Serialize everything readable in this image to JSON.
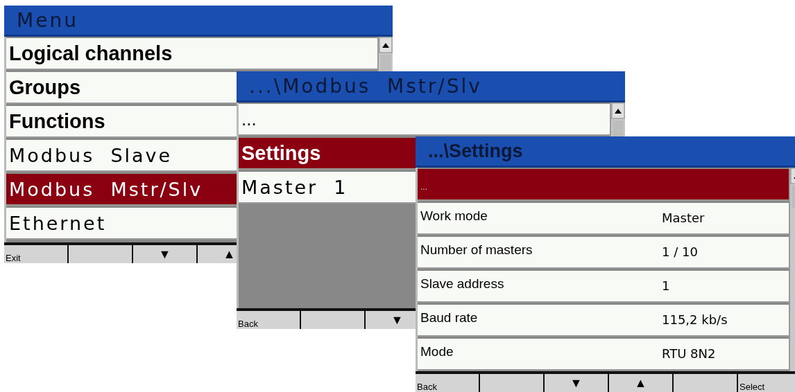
{
  "windows": [
    {
      "title": {
        "text": "Menu",
        "kind": "wide"
      },
      "items": [
        {
          "label": "Logical channels",
          "kind": "bold",
          "selected": false
        },
        {
          "label": "Groups",
          "kind": "bold",
          "selected": false
        },
        {
          "label": "Functions",
          "kind": "bold",
          "selected": false
        },
        {
          "label": "Modbus  Slave",
          "kind": "wide",
          "selected": false
        },
        {
          "label": "Modbus  Mstr/Slv",
          "kind": "wide",
          "selected": true
        },
        {
          "label": "Ethernet",
          "kind": "wide",
          "selected": false
        }
      ],
      "buttons": [
        {
          "label": "Exit",
          "kind": "text"
        },
        {
          "kind": "blank"
        },
        {
          "label": "▼",
          "kind": "arrow"
        },
        {
          "label": "▲",
          "kind": "arrow"
        }
      ]
    },
    {
      "title": {
        "text": "...\\Modbus  Mstr/Slv",
        "kind": "wide"
      },
      "items": [
        {
          "label": "...",
          "kind": "plain",
          "selected": false
        },
        {
          "label": "Settings",
          "kind": "bold",
          "selected": true
        },
        {
          "label": "Master  1",
          "kind": "wide",
          "selected": false
        }
      ],
      "buttons": [
        {
          "label": "Back",
          "kind": "text"
        },
        {
          "kind": "blank"
        },
        {
          "label": "▼",
          "kind": "arrow"
        }
      ]
    },
    {
      "title": {
        "text": "...\\Settings",
        "kind": "bold"
      },
      "items": [
        {
          "label": "...",
          "kind": "small",
          "selected": true
        },
        {
          "label": "Work mode",
          "value": "Master",
          "kind": "small",
          "selected": false
        },
        {
          "label": "Number of masters",
          "value": "1 / 10",
          "kind": "small",
          "selected": false
        },
        {
          "label": "Slave address",
          "value": "1",
          "kind": "small",
          "selected": false
        },
        {
          "label": "Baud rate",
          "value": "115,2 kb/s",
          "kind": "small",
          "selected": false
        },
        {
          "label": "Mode",
          "value": "RTU 8N2",
          "kind": "small",
          "selected": false
        }
      ],
      "buttons": [
        {
          "label": "Back",
          "kind": "text"
        },
        {
          "kind": "blank"
        },
        {
          "label": "▼",
          "kind": "arrow"
        },
        {
          "label": "▲",
          "kind": "arrow"
        },
        {
          "kind": "blank"
        },
        {
          "label": "Select",
          "kind": "text"
        }
      ]
    }
  ]
}
